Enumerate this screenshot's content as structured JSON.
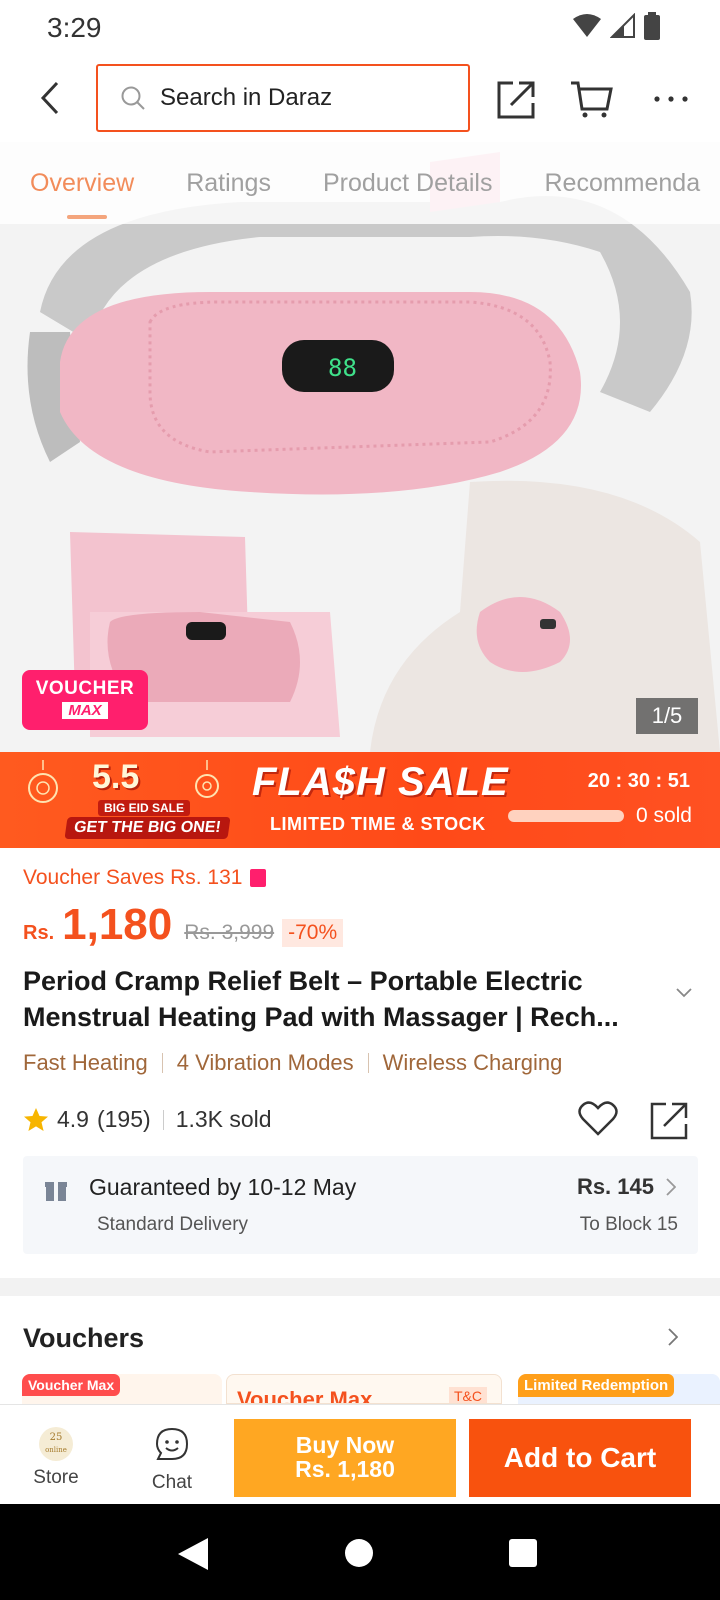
{
  "status": {
    "time": "3:29"
  },
  "header": {
    "search_placeholder": "Search in Daraz"
  },
  "tabs": [
    {
      "label": "Overview",
      "active": true
    },
    {
      "label": "Ratings",
      "active": false
    },
    {
      "label": "Product Details",
      "active": false
    },
    {
      "label": "Recommenda",
      "active": false
    }
  ],
  "gallery": {
    "badge_line1": "VOUCHER",
    "badge_line2": "MAX",
    "counter": "1/5"
  },
  "flash_sale": {
    "promo_number": "5.5",
    "promo_line1": "BIG EID SALE",
    "promo_line2": "GET THE BIG ONE!",
    "title": "FLA$H SALE",
    "subtitle": "LIMITED TIME & STOCK",
    "timer": "20 : 30 :  51",
    "sold_text": "0 sold",
    "sold_fraction": 0
  },
  "price": {
    "voucher_saves": "Voucher Saves Rs. 131",
    "currency": "Rs.",
    "current": "1,180",
    "original": "Rs. 3,999",
    "discount": "-70%"
  },
  "product": {
    "title": "Period Cramp Relief Belt – Portable Electric Menstrual Heating Pad with Massager | Rech...",
    "features": [
      "Fast Heating",
      "4 Vibration Modes",
      "Wireless Charging"
    ]
  },
  "rating": {
    "score": "4.9",
    "count": "(195)",
    "sold": "1.3K sold"
  },
  "delivery": {
    "guarantee": "Guaranteed by 10-12 May",
    "type": "Standard Delivery",
    "price": "Rs. 145",
    "destination": "To Block 15"
  },
  "vouchers": {
    "heading": "Vouchers",
    "tag1": "Voucher Max",
    "card2_title": "Voucher Max",
    "card2_tc": "T&C",
    "tag3": "Limited Redemption"
  },
  "action_bar": {
    "store_label": "Store",
    "store_icon_top": "25",
    "store_icon_bottom": "online",
    "chat_label": "Chat",
    "buy_now_line1": "Buy Now",
    "buy_now_line2": "Rs. 1,180",
    "add_to_cart": "Add to Cart"
  },
  "colors": {
    "accent": "#f4511e",
    "buy_now": "#ffa722",
    "add_to_cart": "#f8520e",
    "voucher_pink": "#ff1f6d"
  }
}
